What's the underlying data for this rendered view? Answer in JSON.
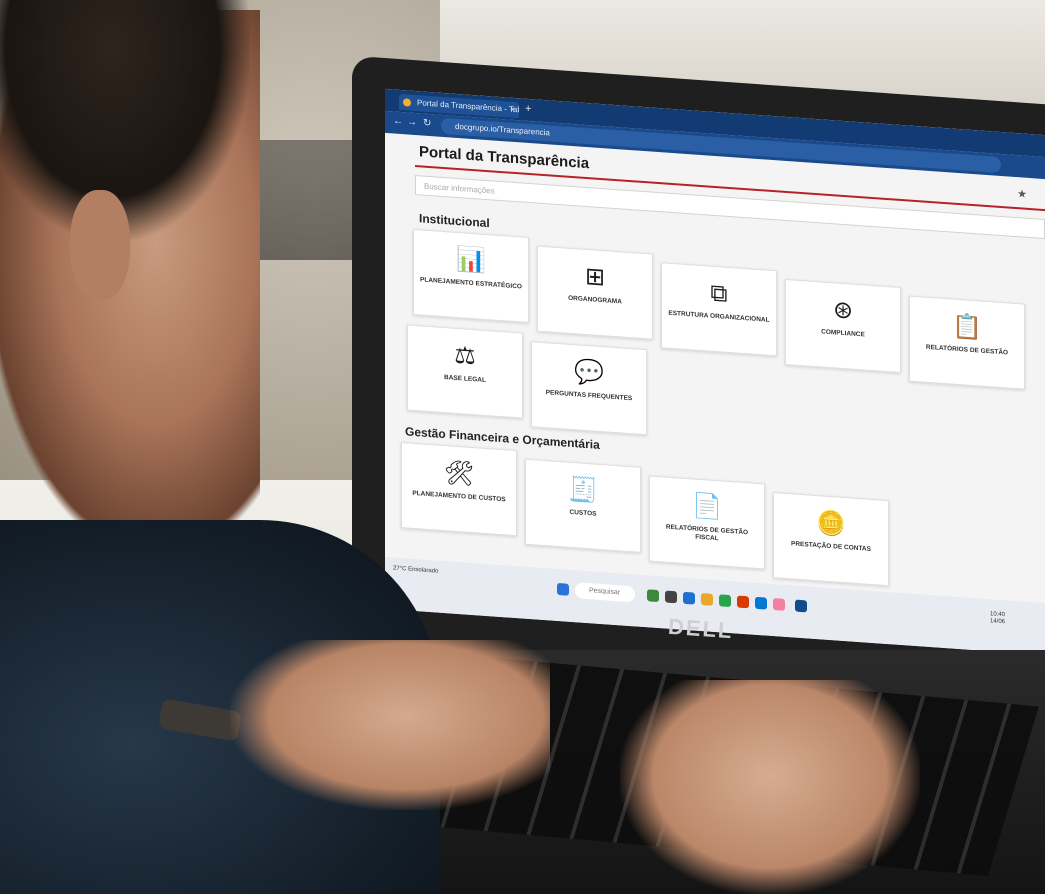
{
  "browser": {
    "tab_title": "Portal da Transparência - Tabs",
    "new_tab": "+",
    "close_tab": "×",
    "url": "docgrupo.io/Transparencia"
  },
  "portal": {
    "title": "Portal da Transparência",
    "search_placeholder": "Buscar informações"
  },
  "sections": {
    "institucional": {
      "title": "Institucional",
      "cards": [
        {
          "label": "PLANEJAMENTO ESTRATÉGICO",
          "icon": "presentation-chart-icon"
        },
        {
          "label": "ORGANOGRAMA",
          "icon": "org-chart-icon"
        },
        {
          "label": "ESTRUTURA ORGANIZACIONAL",
          "icon": "structure-icon"
        },
        {
          "label": "COMPLIANCE",
          "icon": "network-icon"
        },
        {
          "label": "RELATÓRIOS DE GESTÃO",
          "icon": "clipboard-icon"
        },
        {
          "label": "BASE LEGAL",
          "icon": "scales-icon"
        },
        {
          "label": "PERGUNTAS FREQUENTES",
          "icon": "question-bubble-icon"
        }
      ]
    },
    "financeira": {
      "title": "Gestão Financeira e Orçamentária",
      "cards": [
        {
          "label": "PLANEJAMENTO DE CUSTOS",
          "icon": "tools-document-icon"
        },
        {
          "label": "CUSTOS",
          "icon": "invoice-calculator-icon"
        },
        {
          "label": "RELATÓRIOS DE GESTÃO FISCAL",
          "icon": "report-icon"
        },
        {
          "label": "PRESTAÇÃO DE CONTAS",
          "icon": "coins-icon"
        }
      ]
    }
  },
  "taskbar": {
    "search_label": "Pesquisar",
    "weather": "27°C Ensolarado",
    "time": "10:40",
    "date": "14/06"
  },
  "laptop": {
    "brand": "DELL"
  }
}
